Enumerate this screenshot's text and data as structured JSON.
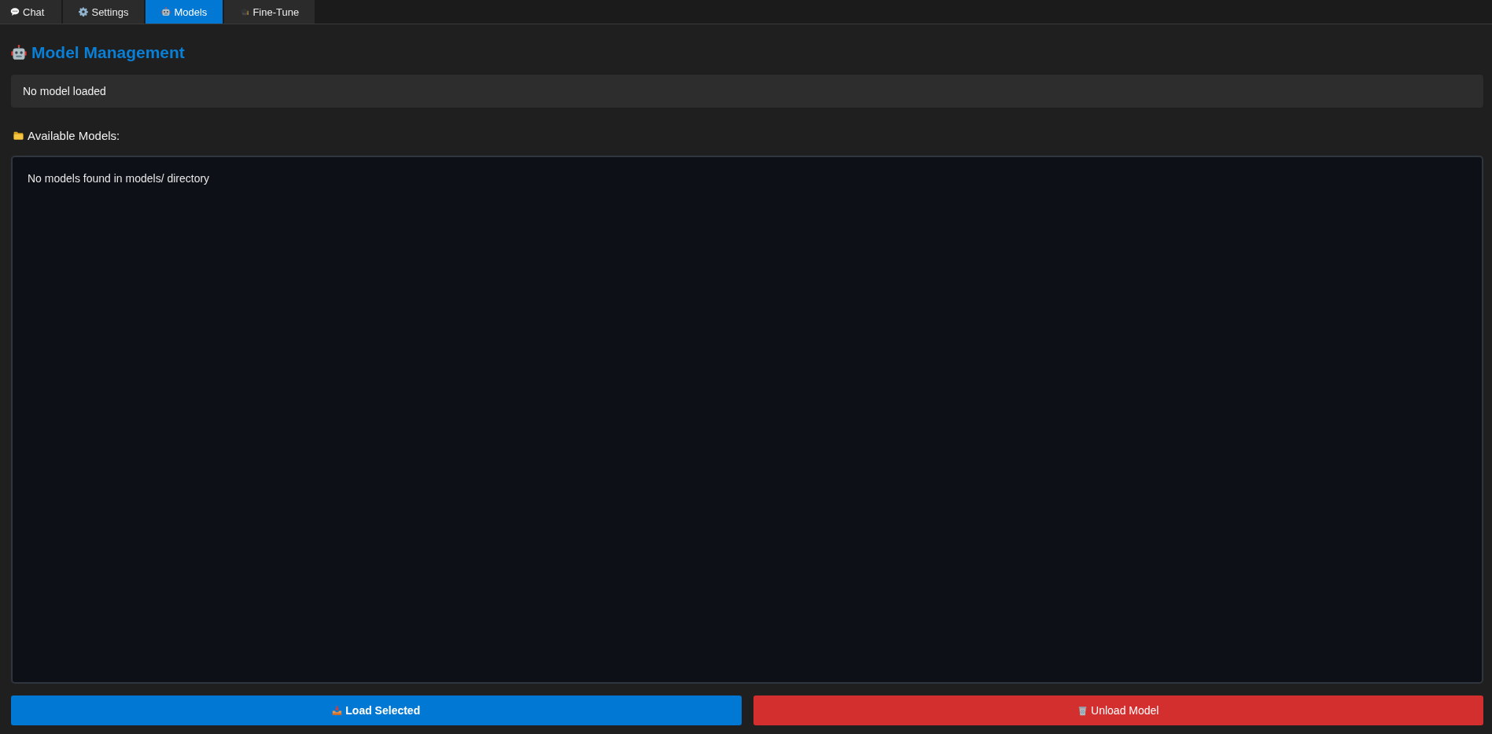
{
  "tabs": [
    {
      "label": "Chat",
      "kind": "chat",
      "selected": false
    },
    {
      "label": "Settings",
      "kind": "settings",
      "selected": false
    },
    {
      "label": "Models",
      "kind": "models",
      "selected": true
    },
    {
      "label": "Fine-Tune",
      "kind": "finetune",
      "selected": false
    }
  ],
  "header": {
    "title": "Model Management"
  },
  "status": {
    "text": "No model loaded"
  },
  "models_section": {
    "label": "Available Models:",
    "empty_message": "No models found in models/ directory"
  },
  "buttons": [
    {
      "label": "Load Selected",
      "kind": "load"
    },
    {
      "label": "Unload Model",
      "kind": "unload"
    }
  ]
}
